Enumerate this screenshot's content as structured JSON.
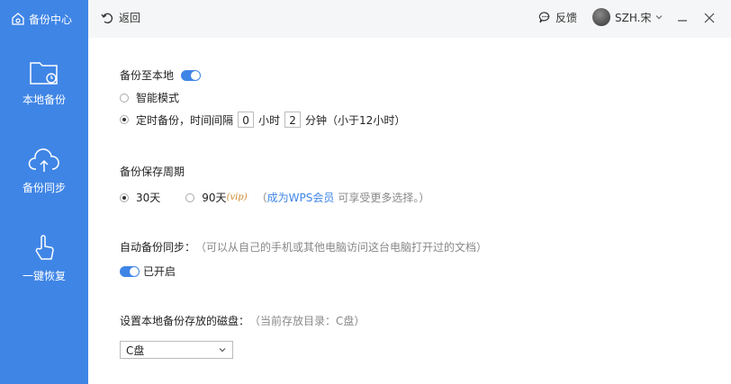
{
  "sidebar": {
    "brand_label": "备份中心",
    "items": [
      {
        "label": "本地备份",
        "icon": "folder-clock-icon"
      },
      {
        "label": "备份同步",
        "icon": "cloud-upload-icon"
      },
      {
        "label": "一键恢复",
        "icon": "hand-pointer-icon"
      }
    ]
  },
  "topbar": {
    "back_label": "返回",
    "feedback_label": "反馈",
    "user_name": "SZH.宋"
  },
  "local_backup": {
    "title": "备份至本地",
    "option_smart": "智能模式",
    "option_timed_prefix": "定时备份，时间间隔",
    "hours_value": "0",
    "hours_unit": "小时",
    "minutes_value": "2",
    "minutes_unit": "分钟",
    "timed_note": "（小于12小时）"
  },
  "retention": {
    "title": "备份保存周期",
    "option_30": "30天",
    "option_90": "90天",
    "vip_tag": "(vip)",
    "note_open": "（",
    "member_link": "成为WPS会员",
    "note_rest": "可享受更多选择。）"
  },
  "sync": {
    "title": "自动备份同步：",
    "note": "（可以从自己的手机或其他电脑访问这台电脑打开过的文档）",
    "toggle_label": "已开启"
  },
  "disk": {
    "title": "设置本地备份存放的磁盘：",
    "note": "（当前存放目录：C盘）",
    "selected": "C盘"
  },
  "colors": {
    "accent": "#3f85e6",
    "topbar_bg": "#f5f6f7"
  }
}
